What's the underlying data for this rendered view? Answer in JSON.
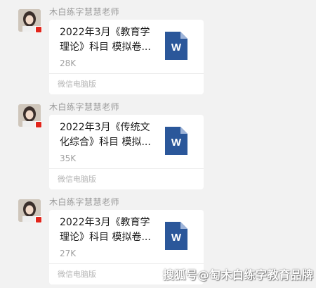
{
  "messages": [
    {
      "sender": "木白练字慧慧老师",
      "file_title": "2022年3月《教育学理论》科目 模拟卷...",
      "file_size": "28K",
      "file_icon": "word-document-icon",
      "icon_letter": "W",
      "footer": "微信电脑版"
    },
    {
      "sender": "木白练字慧慧老师",
      "file_title": "2022年3月《传统文化综合》科目 模拟...",
      "file_size": "35K",
      "file_icon": "word-document-icon",
      "icon_letter": "W",
      "footer": "微信电脑版"
    },
    {
      "sender": "木白练字慧慧老师",
      "file_title": "2022年3月《教育学理论》科目 模拟卷...",
      "file_size": "27K",
      "file_icon": "word-document-icon",
      "icon_letter": "W",
      "footer": "微信电脑版"
    }
  ],
  "watermark": "搜狐号@匋木白练字教育品牌",
  "colors": {
    "background": "#f2f2f2",
    "card": "#ffffff",
    "word_blue": "#2b579a",
    "word_fold": "#9db3d8",
    "flag_red": "#e1251b"
  }
}
